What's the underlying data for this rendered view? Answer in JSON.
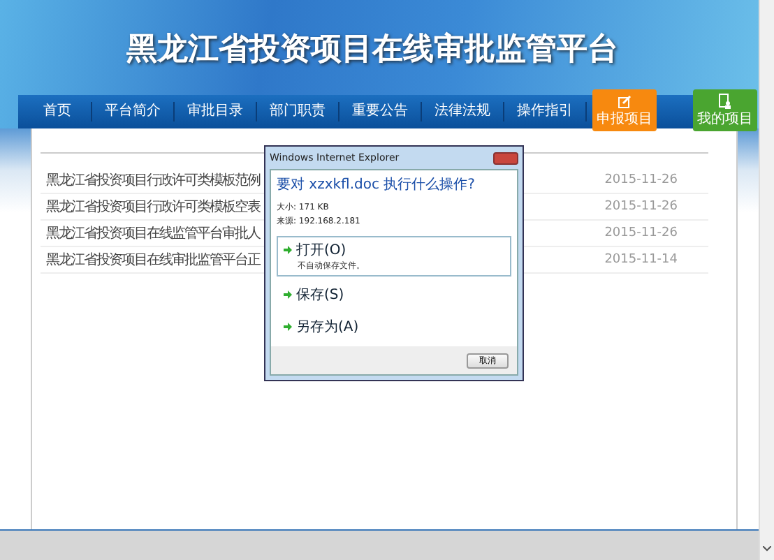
{
  "header": {
    "title": "黑龙江省投资项目在线审批监管平台"
  },
  "nav": {
    "items": [
      {
        "label": "首页"
      },
      {
        "label": "平台简介"
      },
      {
        "label": "审批目录"
      },
      {
        "label": "部门职责"
      },
      {
        "label": "重要公告"
      },
      {
        "label": "法律法规"
      },
      {
        "label": "操作指引"
      }
    ],
    "actions": [
      {
        "label": "申报项目",
        "kind": "declare",
        "color": "#f7890f"
      },
      {
        "label": "我的项目",
        "kind": "mine",
        "color": "#4aa530"
      }
    ]
  },
  "notices": [
    {
      "title": "黑龙江省投资项目行政许可类模板范例",
      "date": "2015-11-26"
    },
    {
      "title": "黑龙江省投资项目行政许可类模板空表",
      "date": "2015-11-26"
    },
    {
      "title": "黑龙江省投资项目在线监管平台审批人",
      "date": "2015-11-26"
    },
    {
      "title": "黑龙江省投资项目在线审批监管平台正",
      "date": "2015-11-14"
    }
  ],
  "dialog": {
    "title": "Windows Internet Explorer",
    "question": "要对 xzxkfl.doc 执行什么操作?",
    "size": "大小: 171 KB",
    "source": "来源: 192.168.2.181",
    "options": [
      {
        "label": "打开(O)",
        "note": "不自动保存文件。",
        "selected": true
      },
      {
        "label": "保存(S)",
        "selected": false
      },
      {
        "label": "另存为(A)",
        "selected": false
      }
    ],
    "cancel": "取消"
  }
}
